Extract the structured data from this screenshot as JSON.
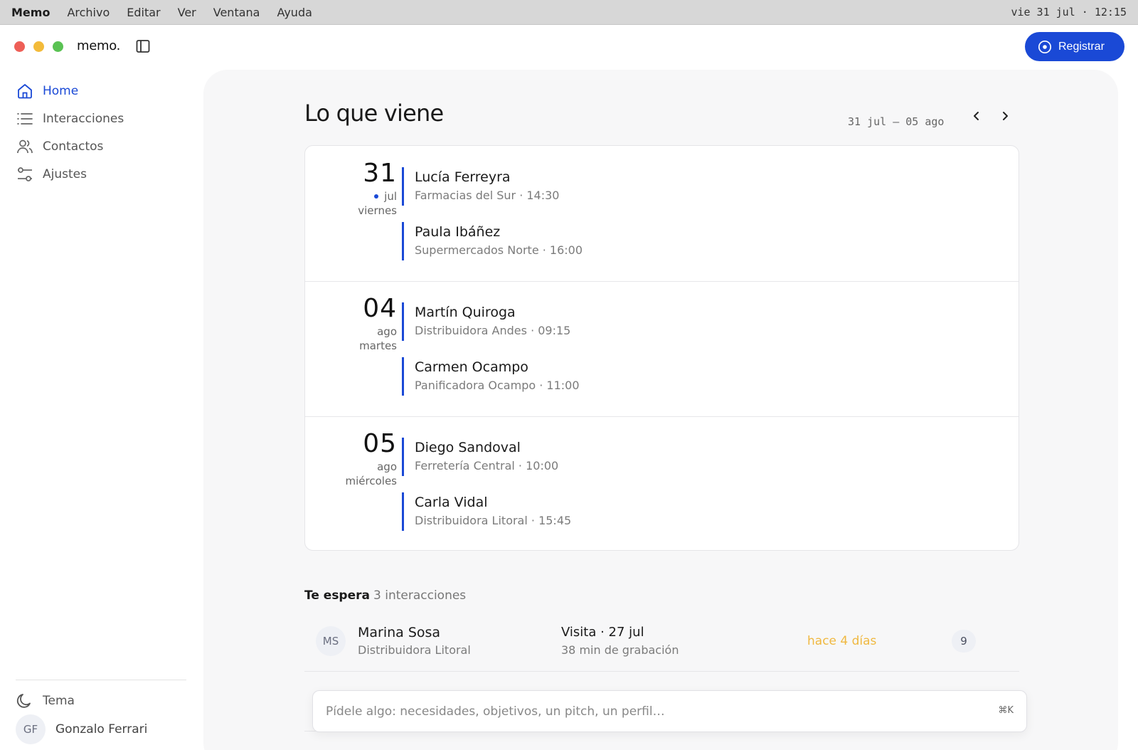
{
  "menubar": {
    "app": "Memo",
    "items": [
      "Archivo",
      "Editar",
      "Ver",
      "Ventana",
      "Ayuda"
    ],
    "clock": "vie 31 jul · 12:15"
  },
  "brand": "memo.",
  "register_button": "Registrar",
  "sidebar": {
    "items": [
      {
        "label": "Home",
        "icon": "home-icon",
        "active": true
      },
      {
        "label": "Interacciones",
        "icon": "list-icon",
        "active": false
      },
      {
        "label": "Contactos",
        "icon": "users-icon",
        "active": false
      },
      {
        "label": "Ajustes",
        "icon": "sliders-icon",
        "active": false
      }
    ],
    "theme_label": "Tema",
    "user": {
      "initials": "GF",
      "name": "Gonzalo Ferrari"
    }
  },
  "upcoming": {
    "title": "Lo que viene",
    "range": "31 jul – 05 ago",
    "days": [
      {
        "num": "31",
        "month": "jul",
        "weekday": "viernes",
        "today": true,
        "events": [
          {
            "name": "Lucía Ferreyra",
            "meta": "Farmacias del Sur · 14:30"
          },
          {
            "name": "Paula Ibáñez",
            "meta": "Supermercados Norte · 16:00"
          }
        ]
      },
      {
        "num": "04",
        "month": "ago",
        "weekday": "martes",
        "today": false,
        "events": [
          {
            "name": "Martín Quiroga",
            "meta": "Distribuidora Andes · 09:15"
          },
          {
            "name": "Carmen Ocampo",
            "meta": "Panificadora Ocampo · 11:00"
          }
        ]
      },
      {
        "num": "05",
        "month": "ago",
        "weekday": "miércoles",
        "today": false,
        "events": [
          {
            "name": "Diego Sandoval",
            "meta": "Ferretería Central · 10:00"
          },
          {
            "name": "Carla Vidal",
            "meta": "Distribuidora Litoral · 15:45"
          }
        ]
      }
    ]
  },
  "waiting": {
    "title": "Te espera",
    "count": "3 interacciones",
    "rows": [
      {
        "initials": "MS",
        "name": "Marina Sosa",
        "company": "Distribuidora Litoral",
        "type": "Visita · 27 jul",
        "duration": "38 min de grabación",
        "age": "hace 4 días",
        "badge": "9"
      }
    ]
  },
  "ask": {
    "placeholder": "Pídele algo: necesidades, objetivos, un pitch, un perfil…",
    "shortcut": "⌘K"
  },
  "colors": {
    "accent": "#1a49d6",
    "warning": "#f0b840"
  }
}
